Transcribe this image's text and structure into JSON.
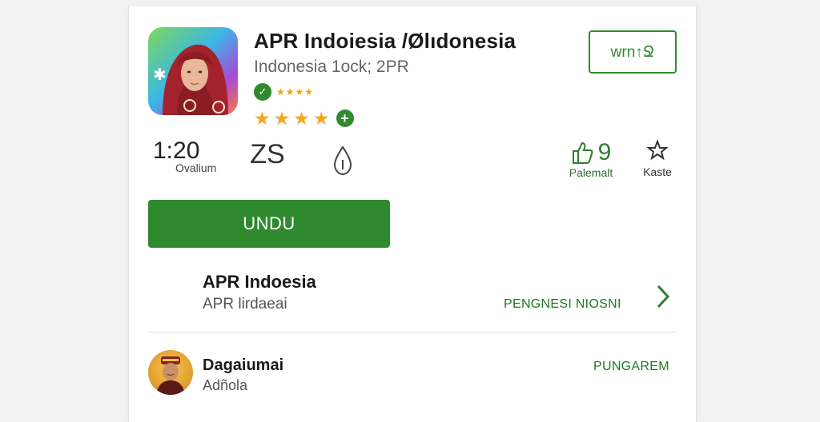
{
  "app": {
    "title": "APR Indoiesia /Ølıdonesia",
    "subtitle": "Indonesia 1ock; 2PR",
    "mini_stars": "★★★★",
    "mini_badge_icon": "check-badge-icon",
    "rating_value": 4,
    "rating_max": 5,
    "plus_label": "+"
  },
  "top_button": {
    "label": "wrn↑Ջ"
  },
  "stats": {
    "downloads_value": "1:20",
    "downloads_label": "Ovalium",
    "rating_value": "ZS",
    "likes_value": "9",
    "likes_label": "Palemalt",
    "share_label": "Kaste"
  },
  "install_button": {
    "label": "UNDU"
  },
  "developer_row": {
    "title": "APR Indoesia",
    "subtitle": "APR lirdaeai",
    "link_label": "PENGNESI NIOSNI",
    "chevron": "›"
  },
  "review": {
    "name": "Dagaiumai",
    "subtitle": "Adñola",
    "action_label": "PUNGAREM"
  },
  "colors": {
    "accent": "#2e8b2e",
    "star": "#f5a623",
    "background": "#f2f2f2"
  }
}
